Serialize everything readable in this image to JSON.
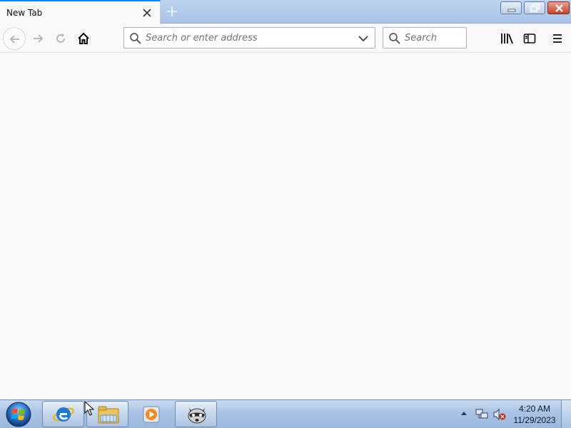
{
  "browser": {
    "tab": {
      "title": "New Tab",
      "close_icon": "close-icon"
    },
    "new_tab_icon": "plus-icon",
    "window_controls": [
      "minimize-icon",
      "restore-icon",
      "close-icon"
    ],
    "nav": {
      "back_icon": "arrow-left-icon",
      "forward_icon": "arrow-right-icon",
      "reload_icon": "reload-icon",
      "home_icon": "home-icon"
    },
    "urlbar": {
      "placeholder": "Search or enter address",
      "value": "",
      "dropdown_icon": "chevron-down-icon"
    },
    "searchbar": {
      "placeholder": "Search",
      "value": ""
    },
    "toolbar_icons": [
      "library-icon",
      "sidebar-icon",
      "hamburger-menu-icon"
    ],
    "accent_color": "#0a84ff",
    "content_background": "#f9f9fa"
  },
  "taskbar": {
    "start_icon": "windows-start-orb-icon",
    "pinned": [
      "internet-explorer-icon",
      "file-explorer-icon",
      "media-player-icon",
      "raccoon-app-icon"
    ],
    "tray_icons": [
      "show-hidden-icons-arrow",
      "network-icon",
      "volume-muted-icon"
    ],
    "clock": {
      "time": "4:20 AM",
      "date": "11/29/2023"
    }
  }
}
